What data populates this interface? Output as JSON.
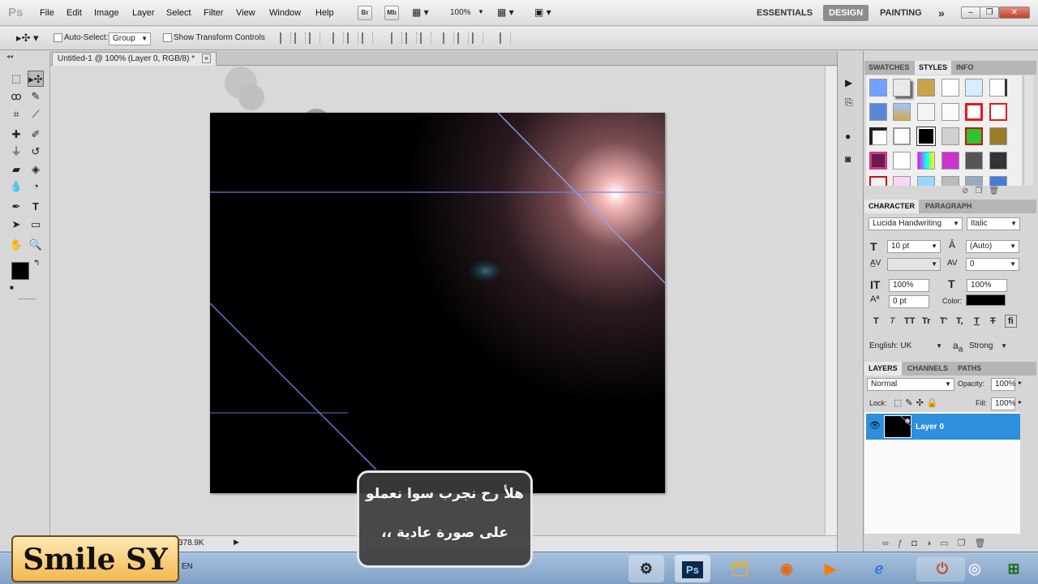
{
  "app": {
    "logo": "Ps"
  },
  "menu": [
    "File",
    "Edit",
    "Image",
    "Layer",
    "Select",
    "Filter",
    "View",
    "Window",
    "Help"
  ],
  "menubar_buttons": {
    "bridge": "Br",
    "minibridge": "Mb",
    "zoom": "100%"
  },
  "workspaces": {
    "essentials": "ESSENTIALS",
    "design": "DESIGN",
    "painting": "PAINTING",
    "more": "»"
  },
  "options_bar": {
    "auto_select_label": "Auto-Select:",
    "auto_select_value": "Group",
    "transform_label": "Show Transform Controls"
  },
  "document": {
    "tab_title": "Untitled-1 @ 100% (Layer 0, RGB/8) *",
    "close": "×",
    "status": "378.9K"
  },
  "panels": {
    "swatches_tabs": [
      "SWATCHES",
      "STYLES",
      "INFO"
    ],
    "character_tabs": [
      "CHARACTER",
      "PARAGRAPH"
    ],
    "font_family": "Lucida Handwriting",
    "font_style": "Italic",
    "font_size": "10 pt",
    "leading": "(Auto)",
    "tracking": "0",
    "vertical_scale": "100%",
    "horizontal_scale": "100%",
    "baseline": "0 pt",
    "color_label": "Color:",
    "language": "English: UK",
    "antialias_label": "a",
    "antialias": "Strong",
    "type_buttons": [
      "T",
      "T",
      "TT",
      "Tr",
      "T'",
      "T,",
      "T",
      "T",
      "fi"
    ],
    "layers_tabs": [
      "LAYERS",
      "CHANNELS",
      "PATHS"
    ],
    "blend_mode": "Normal",
    "opacity_label": "Opacity:",
    "opacity": "100%",
    "lock_label": "Lock:",
    "fill_label": "Fill:",
    "fill": "100%",
    "layer_name": "Layer 0"
  },
  "overlay": {
    "watermark": "Smile SY",
    "caption_line1": "هلأ رح نجرب سوا نعملو",
    "caption_line2": "على صورة عادية ،،"
  },
  "taskbar": {
    "lang": "EN",
    "ps": "Ps"
  }
}
